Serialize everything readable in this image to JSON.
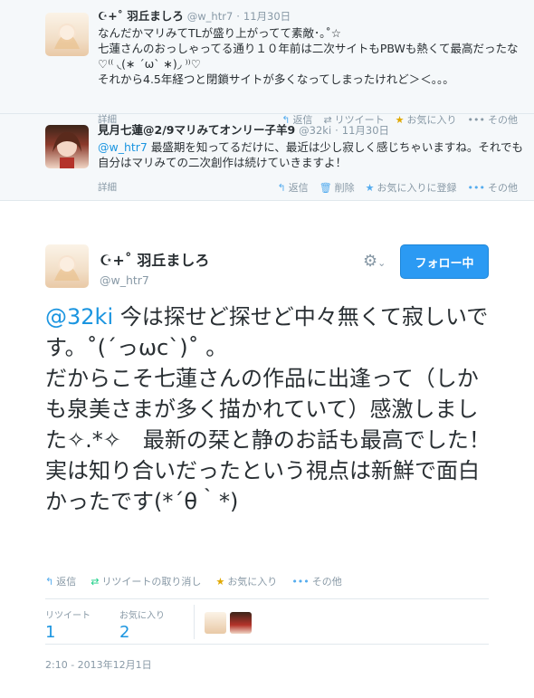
{
  "replies": [
    {
      "name": "☪+˚ 羽丘ましろ",
      "handle": "@w_htr7",
      "date": "11月30日",
      "lines": [
        "なんだかマリみてTLが盛り上がってて素敵･｡˚☆",
        "七蓮さんのおっしゃってる通り１０年前は二次サイトもPBWも熱くて最高だったな♡⁽⁽ ◟(∗ ˊωˋ ∗)◞ ⁾⁾♡",
        "それから4.5年経つと閉鎖サイトが多くなってしまったけれど＞＜。。。"
      ],
      "detail": "詳細",
      "actions": [
        "返信",
        "リツイート",
        "お気に入り",
        "その他"
      ]
    },
    {
      "name": "見月七蓮@2/9マリみてオンリー子羊9",
      "handle": "@32ki",
      "date": "11月30日",
      "mention": "@w_htr7",
      "text": " 最盛期を知ってるだけに、最近は少し寂しく感じちゃいますね。それでも自分はマリみての二次創作は続けていきますよ！",
      "detail": "詳細",
      "actions": [
        "返信",
        "削除",
        "お気に入りに登録",
        "その他"
      ]
    }
  ],
  "main": {
    "name": "☪+˚ 羽丘ましろ",
    "handle": "@w_htr7",
    "follow_label": "フォロー中",
    "mention": "@32ki",
    "text": " 今は探せど探せど中々無くて寂しいです。˚(´っωc`)˚ 。\nだからこそ七蓮さんの作品に出逢って（しかも泉美さまが多く描かれていて）感激しました✧.*✧　最新の栞と静のお話も最高でした！実は知り合いだったという視点は新鮮で面白かったです(*´θ｀*)",
    "actions": [
      "返信",
      "リツイートの取り消し",
      "お気に入り",
      "その他"
    ],
    "stats": [
      {
        "label": "リツイート",
        "value": "1"
      },
      {
        "label": "お気に入り",
        "value": "2"
      }
    ],
    "timestamp": "2:10 - 2013年12月1日"
  }
}
